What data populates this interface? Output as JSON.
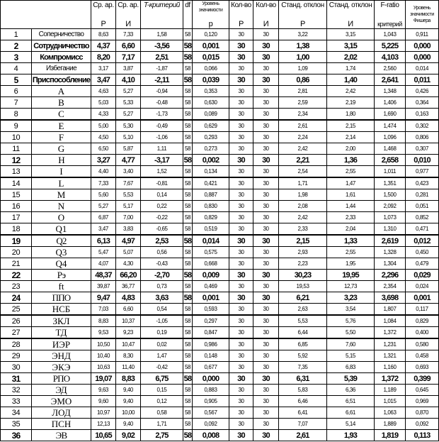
{
  "header": {
    "mean": "Ср. ар.",
    "t_test": "T-критерий",
    "df": "df",
    "significance": "Уровень значимости",
    "count": "Кол-во",
    "count2": "Кол-во",
    "std": "Станд. отклон",
    "std2": "Станд. отклон",
    "f_ratio": "F-ratio",
    "fisher_significance": "Уровень значимости Фишера",
    "group_r": "Р",
    "group_i": "И",
    "p": "p",
    "criterion": "критерий"
  },
  "rows": [
    {
      "n": "1",
      "name": "Соперничество",
      "mr": "8,63",
      "mi": "7,33",
      "t": "1,58",
      "df": "58",
      "p": "0,120",
      "cr": "30",
      "ci": "30",
      "sr": "3,22",
      "si": "3,15",
      "f": "1,043",
      "fp": "0,911",
      "bold": false
    },
    {
      "n": "2",
      "name": "Сотрудничество",
      "mr": "4,37",
      "mi": "6,60",
      "t": "-3,56",
      "df": "58",
      "p": "0,001",
      "cr": "30",
      "ci": "30",
      "sr": "1,38",
      "si": "3,15",
      "f": "5,225",
      "fp": "0,000",
      "bold": true
    },
    {
      "n": "3",
      "name": "Компромисс",
      "mr": "8,20",
      "mi": "7,17",
      "t": "2,51",
      "df": "58",
      "p": "0,015",
      "cr": "30",
      "ci": "30",
      "sr": "1,00",
      "si": "2,02",
      "f": "4,103",
      "fp": "0,000",
      "bold": true
    },
    {
      "n": "4",
      "name": "Избегание",
      "mr": "3,17",
      "mi": "3,87",
      "t": "-1,87",
      "df": "58",
      "p": "0,066",
      "cr": "30",
      "ci": "30",
      "sr": "1,09",
      "si": "1,74",
      "f": "2,560",
      "fp": "0,014",
      "bold": false
    },
    {
      "n": "5",
      "name": "Приспособление",
      "mr": "3,47",
      "mi": "4,10",
      "t": "-2,11",
      "df": "58",
      "p": "0,039",
      "cr": "30",
      "ci": "30",
      "sr": "0,86",
      "si": "1,40",
      "f": "2,641",
      "fp": "0,011",
      "bold": true
    },
    {
      "n": "6",
      "name": "A",
      "mr": "4,63",
      "mi": "5,27",
      "t": "-0,94",
      "df": "58",
      "p": "0,353",
      "cr": "30",
      "ci": "30",
      "sr": "2,81",
      "si": "2,42",
      "f": "1,348",
      "fp": "0,426",
      "bold": false
    },
    {
      "n": "7",
      "name": "B",
      "mr": "5,03",
      "mi": "5,33",
      "t": "-0,48",
      "df": "58",
      "p": "0,630",
      "cr": "30",
      "ci": "30",
      "sr": "2,59",
      "si": "2,19",
      "f": "1,406",
      "fp": "0,364",
      "bold": false
    },
    {
      "n": "8",
      "name": "C",
      "mr": "4,33",
      "mi": "5,27",
      "t": "-1,73",
      "df": "58",
      "p": "0,089",
      "cr": "30",
      "ci": "30",
      "sr": "2,34",
      "si": "1,80",
      "f": "1,690",
      "fp": "0,163",
      "bold": false
    },
    {
      "n": "9",
      "name": "E",
      "mr": "5,00",
      "mi": "5,30",
      "t": "-0,49",
      "df": "58",
      "p": "0,629",
      "cr": "30",
      "ci": "30",
      "sr": "2,61",
      "si": "2,15",
      "f": "1,474",
      "fp": "0,302",
      "bold": false
    },
    {
      "n": "10",
      "name": "F",
      "mr": "4,50",
      "mi": "5,10",
      "t": "-1,06",
      "df": "58",
      "p": "0,293",
      "cr": "30",
      "ci": "30",
      "sr": "2,24",
      "si": "2,14",
      "f": "1,096",
      "fp": "0,806",
      "bold": false
    },
    {
      "n": "11",
      "name": "G",
      "mr": "6,50",
      "mi": "5,87",
      "t": "1,11",
      "df": "58",
      "p": "0,273",
      "cr": "30",
      "ci": "30",
      "sr": "2,42",
      "si": "2,00",
      "f": "1,468",
      "fp": "0,307",
      "bold": false
    },
    {
      "n": "12",
      "name": "H",
      "mr": "3,27",
      "mi": "4,77",
      "t": "-3,17",
      "df": "58",
      "p": "0,002",
      "cr": "30",
      "ci": "30",
      "sr": "2,21",
      "si": "1,36",
      "f": "2,658",
      "fp": "0,010",
      "bold": true
    },
    {
      "n": "13",
      "name": "I",
      "mr": "4,40",
      "mi": "3,40",
      "t": "1,52",
      "df": "58",
      "p": "0,134",
      "cr": "30",
      "ci": "30",
      "sr": "2,54",
      "si": "2,55",
      "f": "1,011",
      "fp": "0,977",
      "bold": false
    },
    {
      "n": "14",
      "name": "L",
      "mr": "7,33",
      "mi": "7,67",
      "t": "-0,81",
      "df": "58",
      "p": "0,421",
      "cr": "30",
      "ci": "30",
      "sr": "1,71",
      "si": "1,47",
      "f": "1,351",
      "fp": "0,423",
      "bold": false
    },
    {
      "n": "15",
      "name": "M",
      "mr": "5,60",
      "mi": "5,53",
      "t": "0,14",
      "df": "58",
      "p": "0,887",
      "cr": "30",
      "ci": "30",
      "sr": "1,98",
      "si": "1,61",
      "f": "1,500",
      "fp": "0,281",
      "bold": false
    },
    {
      "n": "16",
      "name": "N",
      "mr": "5,27",
      "mi": "5,17",
      "t": "0,22",
      "df": "58",
      "p": "0,830",
      "cr": "30",
      "ci": "30",
      "sr": "2,08",
      "si": "1,44",
      "f": "2,092",
      "fp": "0,051",
      "bold": false
    },
    {
      "n": "17",
      "name": "O",
      "mr": "6,87",
      "mi": "7,00",
      "t": "-0,22",
      "df": "58",
      "p": "0,829",
      "cr": "30",
      "ci": "30",
      "sr": "2,42",
      "si": "2,33",
      "f": "1,073",
      "fp": "0,852",
      "bold": false
    },
    {
      "n": "18",
      "name": "Q1",
      "mr": "3,47",
      "mi": "3,83",
      "t": "-0,65",
      "df": "58",
      "p": "0,519",
      "cr": "30",
      "ci": "30",
      "sr": "2,33",
      "si": "2,04",
      "f": "1,310",
      "fp": "0,471",
      "bold": false
    },
    {
      "n": "19",
      "name": "Q2",
      "mr": "6,13",
      "mi": "4,97",
      "t": "2,53",
      "df": "58",
      "p": "0,014",
      "cr": "30",
      "ci": "30",
      "sr": "2,15",
      "si": "1,33",
      "f": "2,619",
      "fp": "0,012",
      "bold": true
    },
    {
      "n": "20",
      "name": "Q3",
      "mr": "5,47",
      "mi": "5,07",
      "t": "0,56",
      "df": "58",
      "p": "0,575",
      "cr": "30",
      "ci": "30",
      "sr": "2,93",
      "si": "2,55",
      "f": "1,328",
      "fp": "0,450",
      "bold": false
    },
    {
      "n": "21",
      "name": "Q4",
      "mr": "4,07",
      "mi": "4,30",
      "t": "-0,43",
      "df": "58",
      "p": "0,668",
      "cr": "30",
      "ci": "30",
      "sr": "2,23",
      "si": "1,95",
      "f": "1,304",
      "fp": "0,479",
      "bold": false
    },
    {
      "n": "22",
      "name": "Рэ",
      "mr": "48,37",
      "mi": "66,20",
      "t": "-2,70",
      "df": "58",
      "p": "0,009",
      "cr": "30",
      "ci": "30",
      "sr": "30,23",
      "si": "19,95",
      "f": "2,296",
      "fp": "0,029",
      "bold": true
    },
    {
      "n": "23",
      "name": "ft",
      "mr": "39,87",
      "mi": "36,77",
      "t": "0,73",
      "df": "58",
      "p": "0,469",
      "cr": "30",
      "ci": "30",
      "sr": "19,53",
      "si": "12,73",
      "f": "2,354",
      "fp": "0,024",
      "bold": false
    },
    {
      "n": "24",
      "name": "ППО",
      "mr": "9,47",
      "mi": "4,83",
      "t": "3,63",
      "df": "58",
      "p": "0,001",
      "cr": "30",
      "ci": "30",
      "sr": "6,21",
      "si": "3,23",
      "f": "3,698",
      "fp": "0,001",
      "bold": true
    },
    {
      "n": "25",
      "name": "НСБ",
      "mr": "7,03",
      "mi": "6,60",
      "t": "0,54",
      "df": "58",
      "p": "0,593",
      "cr": "30",
      "ci": "30",
      "sr": "2,63",
      "si": "3,54",
      "f": "1,807",
      "fp": "0,117",
      "bold": false
    },
    {
      "n": "26",
      "name": "ЗКЛ",
      "mr": "8,83",
      "mi": "10,37",
      "t": "-1,05",
      "df": "58",
      "p": "0,297",
      "cr": "30",
      "ci": "30",
      "sr": "5,53",
      "si": "5,76",
      "f": "1,084",
      "fp": "0,829",
      "bold": false
    },
    {
      "n": "27",
      "name": "ТД",
      "mr": "9,53",
      "mi": "9,23",
      "t": "0,19",
      "df": "58",
      "p": "0,847",
      "cr": "30",
      "ci": "30",
      "sr": "6,44",
      "si": "5,50",
      "f": "1,372",
      "fp": "0,400",
      "bold": false
    },
    {
      "n": "28",
      "name": "ИЭР",
      "mr": "10,50",
      "mi": "10,47",
      "t": "0,02",
      "df": "58",
      "p": "0,986",
      "cr": "30",
      "ci": "30",
      "sr": "6,85",
      "si": "7,60",
      "f": "1,231",
      "fp": "0,580",
      "bold": false
    },
    {
      "n": "29",
      "name": "ЭНД",
      "mr": "10,40",
      "mi": "8,30",
      "t": "1,47",
      "df": "58",
      "p": "0,148",
      "cr": "30",
      "ci": "30",
      "sr": "5,92",
      "si": "5,15",
      "f": "1,321",
      "fp": "0,458",
      "bold": false
    },
    {
      "n": "30",
      "name": "ЭКЭ",
      "mr": "10,63",
      "mi": "11,40",
      "t": "-0,42",
      "df": "58",
      "p": "0,677",
      "cr": "30",
      "ci": "30",
      "sr": "7,35",
      "si": "6,83",
      "f": "1,160",
      "fp": "0,693",
      "bold": false
    },
    {
      "n": "31",
      "name": "РПО",
      "mr": "19,07",
      "mi": "8,83",
      "t": "6,75",
      "df": "58",
      "p": "0,000",
      "cr": "30",
      "ci": "30",
      "sr": "6,31",
      "si": "5,39",
      "f": "1,372",
      "fp": "0,399",
      "bold": true
    },
    {
      "n": "32",
      "name": "ЭД",
      "mr": "9,63",
      "mi": "9,40",
      "t": "0,15",
      "df": "58",
      "p": "0,883",
      "cr": "30",
      "ci": "30",
      "sr": "5,83",
      "si": "6,36",
      "f": "1,189",
      "fp": "0,645",
      "bold": false
    },
    {
      "n": "33",
      "name": "ЭМО",
      "mr": "9,60",
      "mi": "9,40",
      "t": "0,12",
      "df": "58",
      "p": "0,905",
      "cr": "30",
      "ci": "30",
      "sr": "6,46",
      "si": "6,51",
      "f": "1,015",
      "fp": "0,969",
      "bold": false
    },
    {
      "n": "34",
      "name": "ЛОД",
      "mr": "10,97",
      "mi": "10,00",
      "t": "0,58",
      "df": "58",
      "p": "0,567",
      "cr": "30",
      "ci": "30",
      "sr": "6,41",
      "si": "6,61",
      "f": "1,063",
      "fp": "0,870",
      "bold": false
    },
    {
      "n": "35",
      "name": "ПСН",
      "mr": "12,13",
      "mi": "9,40",
      "t": "1,71",
      "df": "58",
      "p": "0,092",
      "cr": "30",
      "ci": "30",
      "sr": "7,07",
      "si": "5,14",
      "f": "1,889",
      "fp": "0,092",
      "bold": false
    },
    {
      "n": "36",
      "name": "ЭВ",
      "mr": "10,65",
      "mi": "9,02",
      "t": "2,75",
      "df": "58",
      "p": "0,008",
      "cr": "30",
      "ci": "30",
      "sr": "2,61",
      "si": "1,93",
      "f": "1,819",
      "fp": "0,113",
      "bold": true
    }
  ]
}
